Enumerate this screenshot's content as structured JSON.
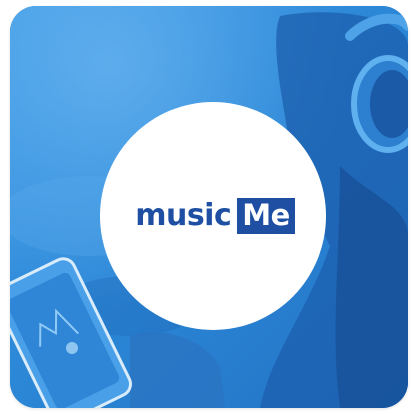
{
  "app": {
    "brand_word": "music",
    "brand_highlight": "Me"
  },
  "colors": {
    "background_blue": "#2a86d8",
    "brand_blue": "#1e4fa3",
    "logo_circle": "#ffffff"
  },
  "icons": {
    "background": "person-with-headphones-holding-phone-photo"
  }
}
